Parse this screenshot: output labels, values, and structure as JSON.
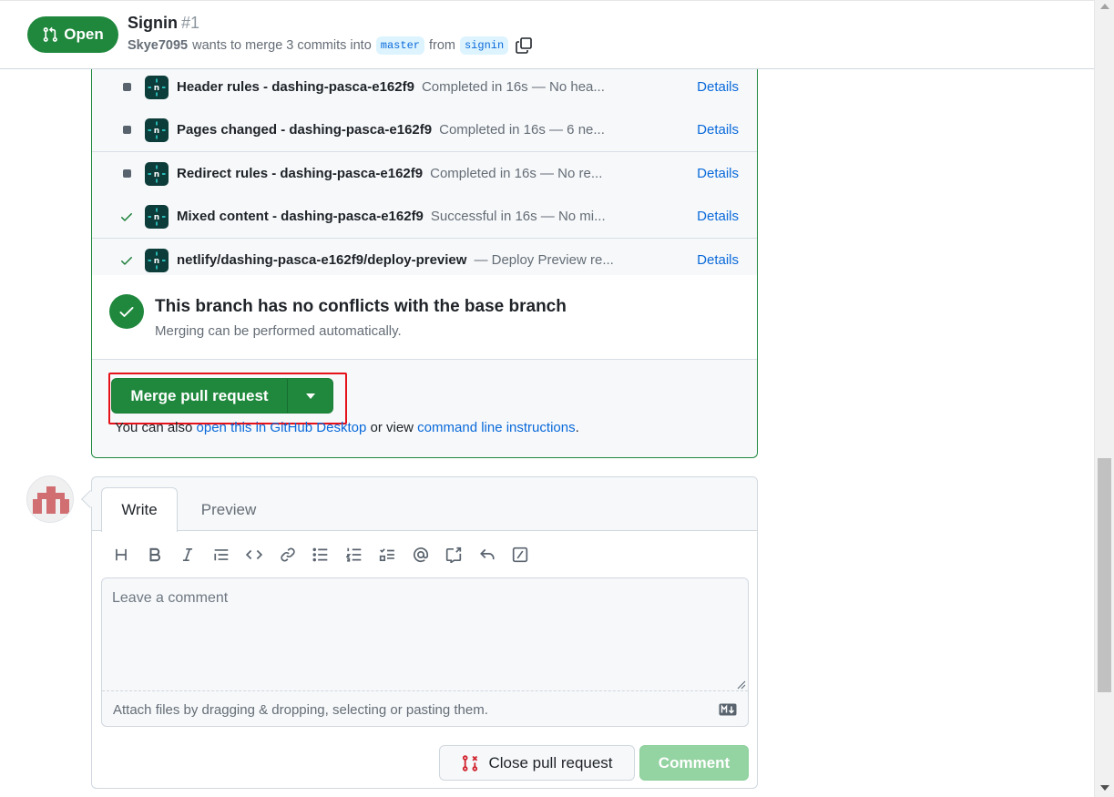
{
  "header": {
    "state_label": "Open",
    "title": "Signin",
    "number": "#1",
    "author": "Skye7095",
    "meta_text": "wants to merge 3 commits into",
    "base_branch": "master",
    "from_text": "from",
    "head_branch": "signin"
  },
  "checks": [
    {
      "status": "neutral",
      "name": "Header rules - dashing-pasca-e162f9",
      "separator": "",
      "description": "Completed in 16s — No hea...",
      "details": "Details"
    },
    {
      "status": "neutral",
      "name": "Pages changed - dashing-pasca-e162f9",
      "separator": "",
      "description": "Completed in 16s — 6 ne...",
      "details": "Details"
    },
    {
      "status": "neutral",
      "name": "Redirect rules - dashing-pasca-e162f9",
      "separator": "",
      "description": "Completed in 16s — No re...",
      "details": "Details"
    },
    {
      "status": "success",
      "name": "Mixed content - dashing-pasca-e162f9",
      "separator": "",
      "description": "Successful in 16s — No mi...",
      "details": "Details"
    },
    {
      "status": "success",
      "name": "netlify/dashing-pasca-e162f9/deploy-preview",
      "separator": "",
      "description": "— Deploy Preview re...",
      "details": "Details"
    }
  ],
  "conflicts": {
    "title": "This branch has no conflicts with the base branch",
    "subtitle": "Merging can be performed automatically."
  },
  "merge": {
    "button_label": "Merge pull request",
    "alt_prefix": "You can also",
    "desktop_link": "open this in GitHub Desktop",
    "alt_middle": "or view",
    "cli_link": "command line instructions",
    "alt_suffix": "."
  },
  "comment": {
    "tab_write": "Write",
    "tab_preview": "Preview",
    "placeholder": "Leave a comment",
    "attach_text": "Attach files by dragging & dropping, selecting or pasting them.",
    "close_button": "Close pull request",
    "comment_button": "Comment",
    "toolbar_icons": [
      "heading-icon",
      "bold-icon",
      "italic-icon",
      "quote-icon",
      "code-icon",
      "link-icon",
      "unordered-list-icon",
      "ordered-list-icon",
      "task-list-icon",
      "mention-icon",
      "cross-reference-icon",
      "reply-icon",
      "slash-commands-icon"
    ]
  },
  "colors": {
    "open_green": "#1f883d",
    "link_blue": "#0969da",
    "highlight_red": "#e5121a",
    "disabled_green": "#94d3a2",
    "netlify_bg": "#0d3d3a"
  }
}
